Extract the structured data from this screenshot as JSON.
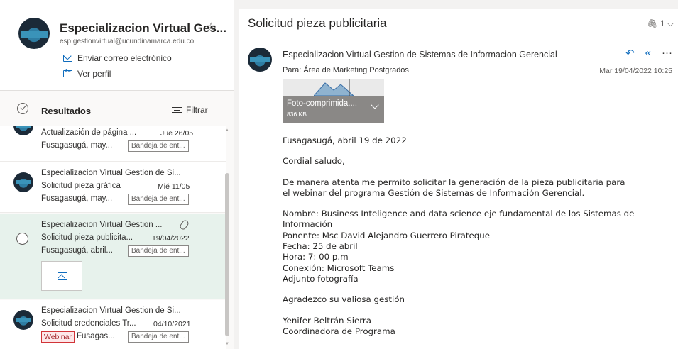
{
  "contact": {
    "name": "Especializacion Virtual Ges...",
    "email": "esp.gestionvirtual@ucundinamarca.edu.co",
    "send_email": "Enviar correo electrónico",
    "view_profile": "Ver perfil"
  },
  "results": {
    "label": "Resultados",
    "filter": "Filtrar"
  },
  "list": [
    {
      "subject": "Actualización de página ...",
      "date": "Jue 26/05",
      "preview": "Fusagasugá, may...",
      "folder": "Bandeja de ent..."
    },
    {
      "sender": "Especializacion Virtual Gestion de Si...",
      "subject": "Solicitud pieza gráfica",
      "date": "Mié 11/05",
      "preview": "Fusagasugá, may...",
      "folder": "Bandeja de ent..."
    },
    {
      "sender": "Especializacion Virtual Gestion ...",
      "subject": "Solicitud pieza publicita...",
      "date": "19/04/2022",
      "preview": "Fusagasugá, abril...",
      "folder": "Bandeja de ent..."
    },
    {
      "sender": "Especializacion Virtual Gestion de Si...",
      "subject": "Solicitud credenciales Tr...",
      "date": "04/10/2021",
      "category": "Webinar",
      "preview": "Fusagas...",
      "folder": "Bandeja de ent..."
    }
  ],
  "message": {
    "subject": "Solicitud pieza publicitaria",
    "attachment_count": "1",
    "sender": "Especializacion Virtual Gestion de Sistemas de Informacion Gerencial",
    "to": "Para:  Área de Marketing Postgrados",
    "date": "Mar 19/04/2022 10:25",
    "attachment": {
      "name": "Foto-comprimida....",
      "size": "836 KB"
    },
    "body": {
      "l1": "Fusagasugá, abril 19  de 2022",
      "l2": "Cordial saludo,",
      "l3": "De manera atenta me permito solicitar la generación  de  la pieza publicitaria para",
      "l4": "el  webinar del programa Gestión de Sistemas de Información Gerencial.",
      "l5": "Nombre:  Business Inteligence and data science eje fundamental de los Sistemas de",
      "l6": "Información",
      "l7": "Ponente: Msc David Alejandro Guerrero  Pirateque",
      "l8": "Fecha: 25 de abril",
      "l9": "Hora: 7: 00 p.m",
      "l10": "Conexión: Microsoft Teams",
      "l11": "Adjunto fotografía",
      "l12": "Agradezco su valiosa gestión",
      "l13": "Yenifer Beltrán Sierra",
      "l14": "Coordinadora de Programa"
    }
  },
  "icons": {
    "star": "star-icon",
    "reply": "reply-icon",
    "reply_all": "reply-all-icon",
    "more": "more-icon",
    "paperclip": "paperclip-icon"
  },
  "colors": {
    "accent": "#0f6cbd",
    "selected_row": "#e7f2ec",
    "category": "#d13438"
  }
}
